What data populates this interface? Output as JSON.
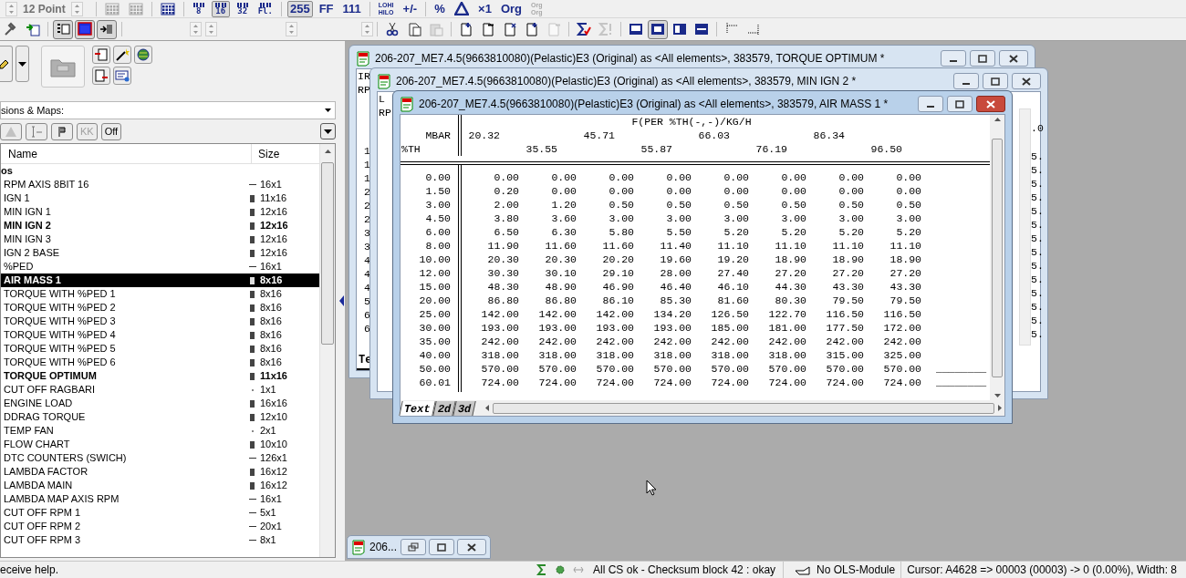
{
  "toolbar_top": {
    "font_size": "12 Point",
    "buttons": [
      {
        "kind": "icon",
        "selected": false,
        "disabled": true
      },
      {
        "kind": "icon",
        "selected": false,
        "disabled": true
      },
      {
        "kind": "icon",
        "selected": false,
        "disabled": false
      },
      {
        "kind": "bits",
        "label": "8",
        "selected": false,
        "disabled": false
      },
      {
        "kind": "bits",
        "label": "16",
        "selected": true,
        "disabled": false
      },
      {
        "kind": "bits",
        "label": "32",
        "selected": false,
        "disabled": false
      },
      {
        "kind": "bits",
        "label": "Fl.",
        "selected": false,
        "disabled": false
      },
      {
        "kind": "text",
        "label": "255",
        "selected": true,
        "disabled": false
      },
      {
        "kind": "text",
        "label": "FF",
        "selected": false,
        "disabled": false
      },
      {
        "kind": "text",
        "label": "111",
        "selected": false,
        "disabled": false
      },
      {
        "kind": "stack",
        "lines": [
          "LOHI",
          "HILO"
        ],
        "selected": false,
        "disabled": false
      },
      {
        "kind": "text",
        "label": "+/-",
        "selected": false,
        "disabled": false
      },
      {
        "kind": "text",
        "label": "%",
        "selected": false,
        "disabled": false
      },
      {
        "kind": "icon",
        "selected": false,
        "disabled": false
      },
      {
        "kind": "text",
        "label": "×1",
        "selected": false,
        "disabled": false
      },
      {
        "kind": "text",
        "label": "Org",
        "selected": false,
        "disabled": false
      },
      {
        "kind": "stack",
        "lines": [
          "Org",
          "Org"
        ],
        "selected": false,
        "disabled": true
      }
    ]
  },
  "toolbar_second": {
    "buttons": [
      {
        "selected": false,
        "disabled": false
      },
      {
        "selected": false,
        "disabled": false
      },
      {
        "selected": true,
        "disabled": false
      },
      {
        "selected": true,
        "disabled": false
      },
      {
        "selected": true,
        "disabled": false
      },
      {
        "selected": false,
        "disabled": false
      },
      {
        "selected": false,
        "disabled": false
      },
      {
        "selected": false,
        "disabled": true
      },
      {
        "selected": false,
        "disabled": false
      },
      {
        "selected": false,
        "disabled": false
      },
      {
        "selected": false,
        "disabled": false
      },
      {
        "selected": false,
        "disabled": false
      },
      {
        "selected": false,
        "disabled": true
      },
      {
        "selected": false,
        "disabled": false
      },
      {
        "selected": false,
        "disabled": true
      },
      {
        "selected": false,
        "disabled": false
      },
      {
        "selected": true,
        "disabled": false
      },
      {
        "selected": false,
        "disabled": false
      },
      {
        "selected": false,
        "disabled": false
      },
      {
        "selected": false,
        "disabled": false
      },
      {
        "selected": false,
        "disabled": false
      }
    ]
  },
  "left_panel": {
    "filter_dropdown": "sions & Maps:",
    "filter_buttons": [
      {
        "kind": "icon",
        "disabled": true
      },
      {
        "kind": "icon",
        "disabled": false
      },
      {
        "kind": "icon",
        "disabled": false
      },
      {
        "kind": "text",
        "label": "KK",
        "disabled": true
      },
      {
        "kind": "text",
        "label": "Off",
        "disabled": false
      }
    ],
    "columns": [
      "Name",
      "Size"
    ],
    "group": "os",
    "items": [
      {
        "name": "RPM AXIS 8BIT 16",
        "size": "16x1",
        "kind": "curve",
        "open": false,
        "selected": false
      },
      {
        "name": "IGN 1",
        "size": "11x16",
        "kind": "map",
        "open": false,
        "selected": false
      },
      {
        "name": "MIN IGN 1",
        "size": "12x16",
        "kind": "map",
        "open": false,
        "selected": false
      },
      {
        "name": "MIN IGN 2",
        "size": "12x16",
        "kind": "map",
        "open": true,
        "selected": false
      },
      {
        "name": "MIN IGN 3",
        "size": "12x16",
        "kind": "map",
        "open": false,
        "selected": false
      },
      {
        "name": "IGN 2 BASE",
        "size": "12x16",
        "kind": "map",
        "open": false,
        "selected": false
      },
      {
        "name": "%PED",
        "size": "16x1",
        "kind": "curve",
        "open": false,
        "selected": false
      },
      {
        "name": "AIR MASS 1",
        "size": "8x16",
        "kind": "map",
        "open": true,
        "selected": true
      },
      {
        "name": "TORQUE WITH %PED 1",
        "size": "8x16",
        "kind": "map",
        "open": false,
        "selected": false
      },
      {
        "name": "TORQUE WITH %PED 2",
        "size": "8x16",
        "kind": "map",
        "open": false,
        "selected": false
      },
      {
        "name": "TORQUE WITH %PED 3",
        "size": "8x16",
        "kind": "map",
        "open": false,
        "selected": false
      },
      {
        "name": "TORQUE WITH %PED 4",
        "size": "8x16",
        "kind": "map",
        "open": false,
        "selected": false
      },
      {
        "name": "TORQUE WITH %PED 5",
        "size": "8x16",
        "kind": "map",
        "open": false,
        "selected": false
      },
      {
        "name": "TORQUE WITH %PED 6",
        "size": "8x16",
        "kind": "map",
        "open": false,
        "selected": false
      },
      {
        "name": "TORQUE OPTIMUM",
        "size": "11x16",
        "kind": "map",
        "open": true,
        "selected": false
      },
      {
        "name": "CUT OFF RAGBARI",
        "size": "1x1",
        "kind": "value",
        "open": false,
        "selected": false
      },
      {
        "name": "ENGINE LOAD",
        "size": "16x16",
        "kind": "map",
        "open": false,
        "selected": false
      },
      {
        "name": "DDRAG TORQUE",
        "size": "12x10",
        "kind": "map",
        "open": false,
        "selected": false
      },
      {
        "name": "TEMP FAN",
        "size": "2x1",
        "kind": "value",
        "open": false,
        "selected": false
      },
      {
        "name": "FLOW CHART",
        "size": "10x10",
        "kind": "map",
        "open": false,
        "selected": false
      },
      {
        "name": "DTC COUNTERS (SWICH)",
        "size": "126x1",
        "kind": "curve",
        "open": false,
        "selected": false
      },
      {
        "name": "LAMBDA FACTOR",
        "size": "16x12",
        "kind": "map",
        "open": false,
        "selected": false
      },
      {
        "name": "LAMBDA MAIN",
        "size": "16x12",
        "kind": "map",
        "open": false,
        "selected": false
      },
      {
        "name": "LAMBDA MAP AXIS RPM",
        "size": "16x1",
        "kind": "curve",
        "open": false,
        "selected": false
      },
      {
        "name": "CUT OFF RPM 1",
        "size": "5x1",
        "kind": "curve",
        "open": false,
        "selected": false
      },
      {
        "name": "CUT OFF RPM 2",
        "size": "20x1",
        "kind": "curve",
        "open": false,
        "selected": false
      },
      {
        "name": "CUT OFF RPM 3",
        "size": "8x1",
        "kind": "curve",
        "open": false,
        "selected": false
      }
    ]
  },
  "windows": [
    {
      "kind": "partial",
      "title": "206-207_ME7.4.5(9663810080)(Pelastic)E3 (Original) as <All elements>, 383579, TORQUE OPTIMUM *",
      "active": false,
      "header_fragments": [
        "IR",
        "RP"
      ],
      "row_fragments": [
        "1",
        "1",
        "1",
        "2",
        "2",
        "2",
        "3",
        "3",
        "4",
        "4",
        "4",
        "5",
        "6",
        "6"
      ],
      "tabs": [
        {
          "label": "Te",
          "selected": true
        }
      ]
    },
    {
      "kind": "partial",
      "title": "206-207_ME7.4.5(9663810080)(Pelastic)E3 (Original) as <All elements>, 383579, MIN IGN 2 *",
      "active": false,
      "header_fragments": [
        "L",
        "RP"
      ],
      "right_fragments": [
        ".0",
        "5.",
        "5.",
        "5.",
        "5.",
        "5.",
        "5.",
        "5.",
        "5.",
        "5.",
        "5.",
        "5.",
        "5.",
        "5.",
        "5."
      ]
    },
    {
      "kind": "table",
      "title": "206-207_ME7.4.5(9663810080)(Pelastic)E3 (Original) as <All elements>, 383579, AIR MASS 1 *",
      "active": true,
      "table": {
        "title": "F(PER %TH(-,-)/KG/H",
        "column_axis_label": "MBAR",
        "row_axis_label": "%TH",
        "column_values": [
          "20.32",
          "35.55",
          "45.71",
          "55.87",
          "66.03",
          "76.19",
          "86.34",
          "96.50"
        ],
        "rows": [
          {
            "axis": "0.00",
            "values": [
              "0.00",
              "0.00",
              "0.00",
              "0.00",
              "0.00",
              "0.00",
              "0.00",
              "0.00"
            ]
          },
          {
            "axis": "1.50",
            "values": [
              "0.20",
              "0.00",
              "0.00",
              "0.00",
              "0.00",
              "0.00",
              "0.00",
              "0.00"
            ]
          },
          {
            "axis": "3.00",
            "values": [
              "2.00",
              "1.20",
              "0.50",
              "0.50",
              "0.50",
              "0.50",
              "0.50",
              "0.50"
            ]
          },
          {
            "axis": "4.50",
            "values": [
              "3.80",
              "3.60",
              "3.00",
              "3.00",
              "3.00",
              "3.00",
              "3.00",
              "3.00"
            ]
          },
          {
            "axis": "6.00",
            "values": [
              "6.50",
              "6.30",
              "5.80",
              "5.50",
              "5.20",
              "5.20",
              "5.20",
              "5.20"
            ]
          },
          {
            "axis": "8.00",
            "values": [
              "11.90",
              "11.60",
              "11.60",
              "11.40",
              "11.10",
              "11.10",
              "11.10",
              "11.10"
            ]
          },
          {
            "axis": "10.00",
            "values": [
              "20.30",
              "20.30",
              "20.20",
              "19.60",
              "19.20",
              "18.90",
              "18.90",
              "18.90"
            ]
          },
          {
            "axis": "12.00",
            "values": [
              "30.30",
              "30.10",
              "29.10",
              "28.00",
              "27.40",
              "27.20",
              "27.20",
              "27.20"
            ]
          },
          {
            "axis": "15.00",
            "values": [
              "48.30",
              "48.90",
              "46.90",
              "46.40",
              "46.10",
              "44.30",
              "43.30",
              "43.30"
            ]
          },
          {
            "axis": "20.00",
            "values": [
              "86.80",
              "86.80",
              "86.10",
              "85.30",
              "81.60",
              "80.30",
              "79.50",
              "79.50"
            ]
          },
          {
            "axis": "25.00",
            "values": [
              "142.00",
              "142.00",
              "142.00",
              "134.20",
              "126.50",
              "122.70",
              "116.50",
              "116.50"
            ]
          },
          {
            "axis": "30.00",
            "values": [
              "193.00",
              "193.00",
              "193.00",
              "193.00",
              "185.00",
              "181.00",
              "177.50",
              "172.00"
            ]
          },
          {
            "axis": "35.00",
            "values": [
              "242.00",
              "242.00",
              "242.00",
              "242.00",
              "242.00",
              "242.00",
              "242.00",
              "242.00"
            ]
          },
          {
            "axis": "40.00",
            "values": [
              "318.00",
              "318.00",
              "318.00",
              "318.00",
              "318.00",
              "318.00",
              "315.00",
              "325.00"
            ]
          },
          {
            "axis": "50.00",
            "values": [
              "570.00",
              "570.00",
              "570.00",
              "570.00",
              "570.00",
              "570.00",
              "570.00",
              "570.00"
            ],
            "marker": "________"
          },
          {
            "axis": "60.01",
            "values": [
              "724.00",
              "724.00",
              "724.00",
              "724.00",
              "724.00",
              "724.00",
              "724.00",
              "724.00"
            ],
            "marker": "________"
          }
        ]
      },
      "tabs": [
        {
          "label": "Text",
          "selected": true
        },
        {
          "label": "2d",
          "selected": false
        },
        {
          "label": "3d",
          "selected": false
        }
      ]
    }
  ],
  "minimized_window": {
    "title": "206..."
  },
  "status_bar": {
    "help": "eceive help.",
    "checksum": "All CS ok - Checksum block 42 : okay",
    "module": "No OLS-Module",
    "cursor": "Cursor: A4628 => 00003 (00003) -> 0 (0.00%), Width: 8"
  }
}
